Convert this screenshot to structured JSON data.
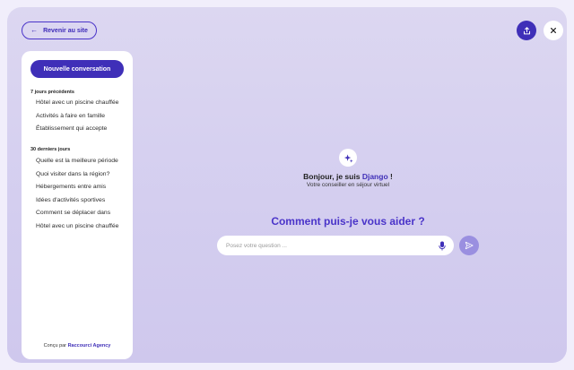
{
  "header": {
    "back_label": "Revenir au site"
  },
  "sidebar": {
    "new_conversation_label": "Nouvelle conversation",
    "sections": [
      {
        "title": "7 jours précédents",
        "items": [
          "Hôtel avec un piscine chauffée",
          "Activités à faire en famille",
          "Établissement qui accepte"
        ]
      },
      {
        "title": "30 derniers jours",
        "items": [
          "Quelle est la meilleure période",
          "Quoi visiter dans la région?",
          "Hébergements entre amis",
          "Idées d'activités sportives",
          "Comment se déplacer dans",
          "Hôtel avec un piscine chauffée"
        ]
      }
    ],
    "footer_prefix": "Conçu par",
    "footer_brand": "Raccourci Agency"
  },
  "assistant": {
    "greeting_prefix": "Bonjour, je suis",
    "name": "Django",
    "greeting_suffix": " !",
    "subtitle": "Votre conseiller en séjour virtuel"
  },
  "chat": {
    "headline": "Comment puis-je vous aider ?",
    "input_placeholder": "Posez votre question ...",
    "input_value": ""
  },
  "icons": {
    "back": "arrow-left-icon",
    "share": "share-icon",
    "close": "close-icon",
    "assistant": "sparkles-icon",
    "mic": "microphone-icon",
    "send": "send-icon"
  },
  "colors": {
    "accent": "#3f2fb8",
    "accent_light": "#9a8fe0",
    "background": "#d6d0f0"
  }
}
